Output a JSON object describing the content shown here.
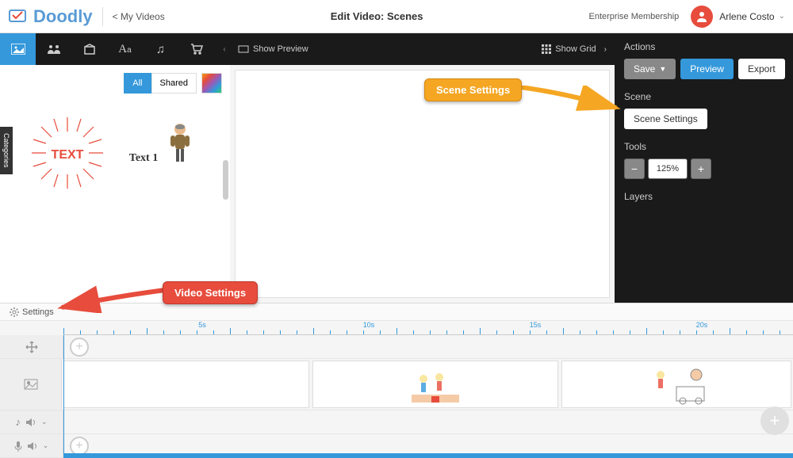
{
  "header": {
    "logo_text": "Doodly",
    "back": "< My Videos",
    "title": "Edit Video: Scenes",
    "membership": "Enterprise Membership",
    "user_name": "Arlene Costo"
  },
  "filters": {
    "all": "All",
    "shared": "Shared"
  },
  "categories_label": "Categories",
  "assets": {
    "text_burst": "TEXT",
    "text1_label": "Text 1"
  },
  "canvas_header": {
    "show_preview": "Show Preview",
    "show_grid": "Show Grid"
  },
  "right": {
    "actions": "Actions",
    "save": "Save",
    "preview": "Preview",
    "export": "Export",
    "scene": "Scene",
    "scene_settings": "Scene Settings",
    "tools": "Tools",
    "zoom": "125%",
    "layers": "Layers"
  },
  "timeline": {
    "settings": "Settings",
    "marks": [
      "5s",
      "10s",
      "15s",
      "20s"
    ]
  },
  "annotations": {
    "scene_settings": "Scene Settings",
    "video_settings": "Video Settings"
  }
}
